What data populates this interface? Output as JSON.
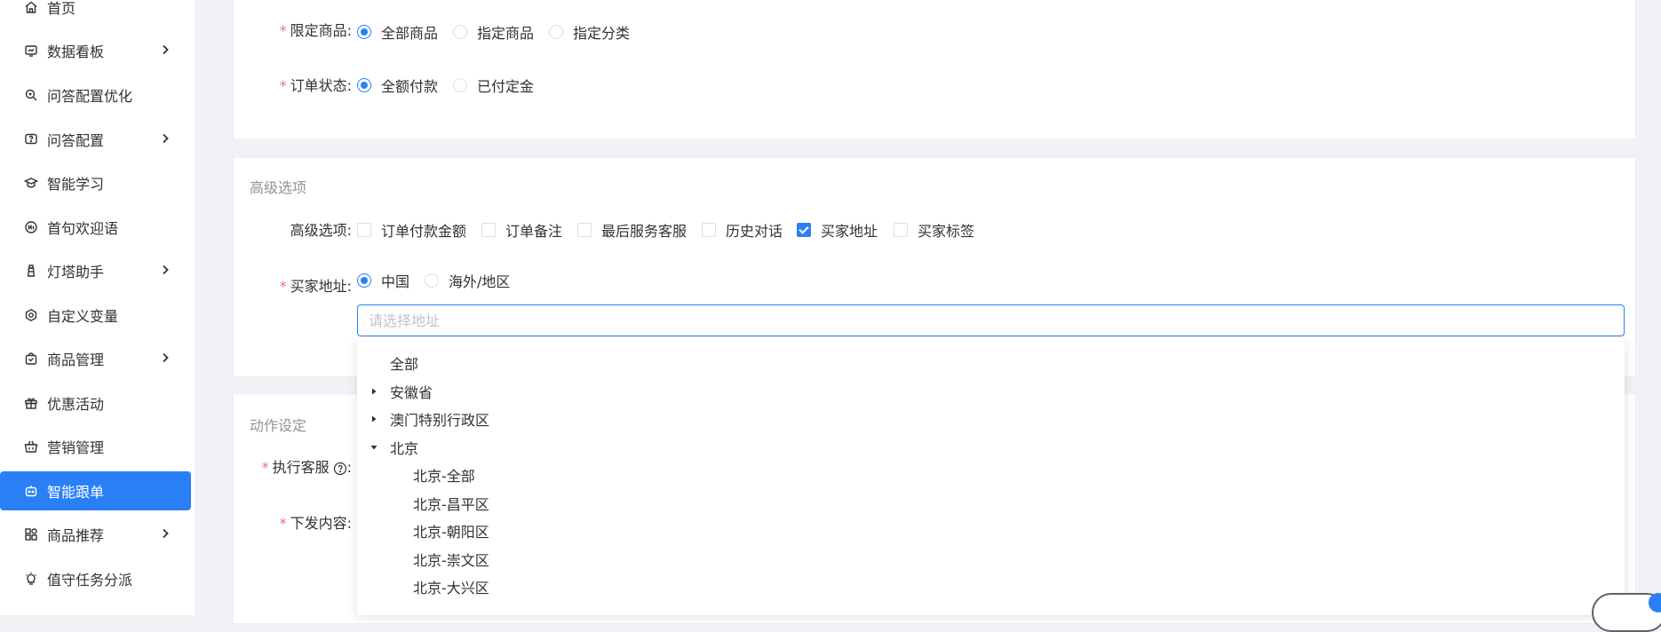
{
  "sidebar": {
    "items": [
      {
        "label": "首页",
        "icon": "home-icon",
        "has_children": false,
        "active": false
      },
      {
        "label": "数据看板",
        "icon": "dashboard-icon",
        "has_children": true,
        "active": false
      },
      {
        "label": "问答配置优化",
        "icon": "search-zoom-icon",
        "has_children": false,
        "active": false
      },
      {
        "label": "问答配置",
        "icon": "question-chat-icon",
        "has_children": true,
        "active": false
      },
      {
        "label": "智能学习",
        "icon": "graduation-cap-icon",
        "has_children": false,
        "active": false
      },
      {
        "label": "首句欢迎语",
        "icon": "hi-badge-icon",
        "has_children": false,
        "active": false
      },
      {
        "label": "灯塔助手",
        "icon": "lighthouse-icon",
        "has_children": true,
        "active": false
      },
      {
        "label": "自定义变量",
        "icon": "settings-ring-icon",
        "has_children": false,
        "active": false
      },
      {
        "label": "商品管理",
        "icon": "shopping-bag-icon",
        "has_children": true,
        "active": false
      },
      {
        "label": "优惠活动",
        "icon": "gift-icon",
        "has_children": false,
        "active": false
      },
      {
        "label": "营销管理",
        "icon": "basket-icon",
        "has_children": false,
        "active": false
      },
      {
        "label": "智能跟单",
        "icon": "robot-icon",
        "has_children": false,
        "active": true
      },
      {
        "label": "商品推荐",
        "icon": "grid-apps-icon",
        "has_children": true,
        "active": false
      },
      {
        "label": "值守任务分派",
        "icon": "bulb-icon",
        "has_children": false,
        "active": false
      }
    ]
  },
  "basic_card": {
    "limit_goods": {
      "label": "限定商品:",
      "options": [
        "全部商品",
        "指定商品",
        "指定分类"
      ],
      "selected": "全部商品"
    },
    "order_status": {
      "label": "订单状态:",
      "options": [
        "全额付款",
        "已付定金"
      ],
      "selected": "全额付款"
    }
  },
  "advanced_card": {
    "title": "高级选项",
    "advanced_options": {
      "label": "高级选项:",
      "options": [
        {
          "label": "订单付款金额",
          "checked": false
        },
        {
          "label": "订单备注",
          "checked": false
        },
        {
          "label": "最后服务客服",
          "checked": false
        },
        {
          "label": "历史对话",
          "checked": false
        },
        {
          "label": "买家地址",
          "checked": true
        },
        {
          "label": "买家标签",
          "checked": false
        }
      ]
    },
    "buyer_address": {
      "label": "买家地址:",
      "options": [
        "中国",
        "海外/地区"
      ],
      "selected": "中国",
      "input_value": "",
      "input_placeholder": "请选择地址"
    }
  },
  "address_tree": {
    "nodes": [
      {
        "label": "全部",
        "level": 0,
        "expander": "none"
      },
      {
        "label": "安徽省",
        "level": 0,
        "expander": "collapsed"
      },
      {
        "label": "澳门特别行政区",
        "level": 0,
        "expander": "collapsed"
      },
      {
        "label": "北京",
        "level": 0,
        "expander": "expanded"
      },
      {
        "label": "北京-全部",
        "level": 1,
        "expander": "none"
      },
      {
        "label": "北京-昌平区",
        "level": 1,
        "expander": "none"
      },
      {
        "label": "北京-朝阳区",
        "level": 1,
        "expander": "none"
      },
      {
        "label": "北京-崇文区",
        "level": 1,
        "expander": "none"
      },
      {
        "label": "北京-大兴区",
        "level": 1,
        "expander": "none"
      }
    ]
  },
  "action_card": {
    "title": "动作设定",
    "executor_label": "执行客服",
    "executor_colon": ":",
    "content_label": "下发内容:"
  },
  "colors": {
    "primary": "#2b7ff5",
    "required": "#f56c6c",
    "background": "#f0f2f5"
  }
}
